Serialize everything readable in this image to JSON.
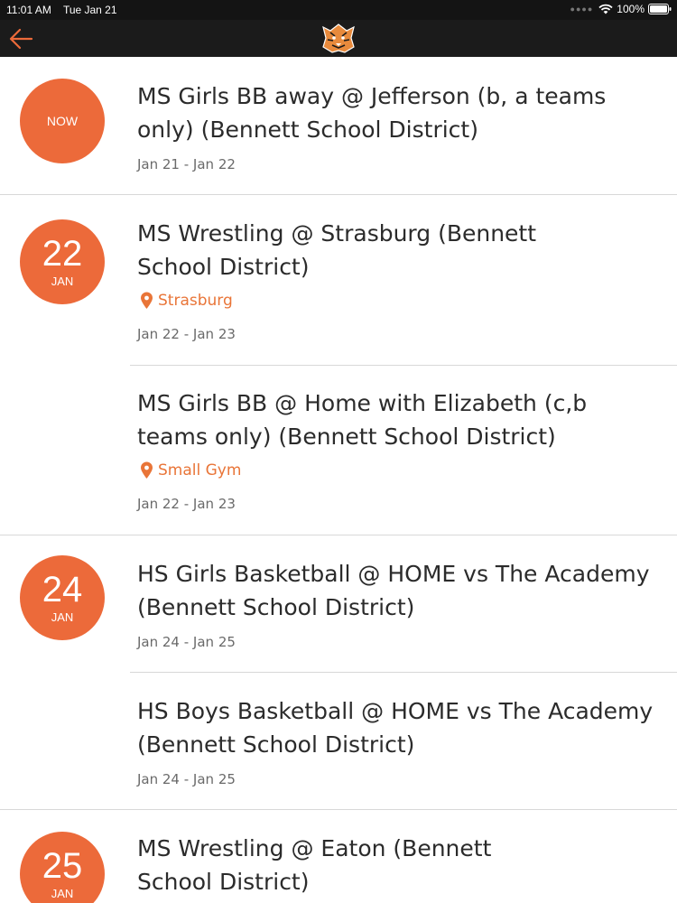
{
  "status": {
    "time": "11:01 AM",
    "date": "Tue Jan 21",
    "battery": "100%"
  },
  "nav": {
    "back_icon": "arrow-left-icon",
    "logo_icon": "tiger-logo-icon",
    "accent": "#ec6a3a"
  },
  "events": [
    {
      "badge": "NOW",
      "title_line1": "MS Girls BB away @ Jefferson (b, a teams",
      "title_line2": "only)  (Bennett School District)",
      "location": "",
      "dates": "Jan 21 - Jan 22"
    },
    {
      "badge_day": "22",
      "badge_month": "JAN",
      "title_line1": "MS Wrestling @ Strasburg (Bennett",
      "title_line2": "School District)",
      "location": "Strasburg",
      "dates": "Jan 22 - Jan 23"
    },
    {
      "title_line1": "MS Girls BB @ Home with Elizabeth (c,b",
      "title_line2": "teams only) (Bennett School District)",
      "location": "Small Gym",
      "dates": "Jan 22 - Jan 23"
    },
    {
      "badge_day": "24",
      "badge_month": "JAN",
      "title_line1": "HS Girls Basketball @ HOME vs The Academy",
      "title_line2": "(Bennett School District)",
      "dates": "Jan 24 - Jan 25"
    },
    {
      "title_line1": "HS Boys Basketball @ HOME vs The Academy",
      "title_line2": "(Bennett School District)",
      "dates": "Jan 24 - Jan 25"
    },
    {
      "badge_day": "25",
      "badge_month": "JAN",
      "title_line1": "MS Wrestling @ Eaton (Bennett",
      "title_line2": "School District)"
    }
  ]
}
